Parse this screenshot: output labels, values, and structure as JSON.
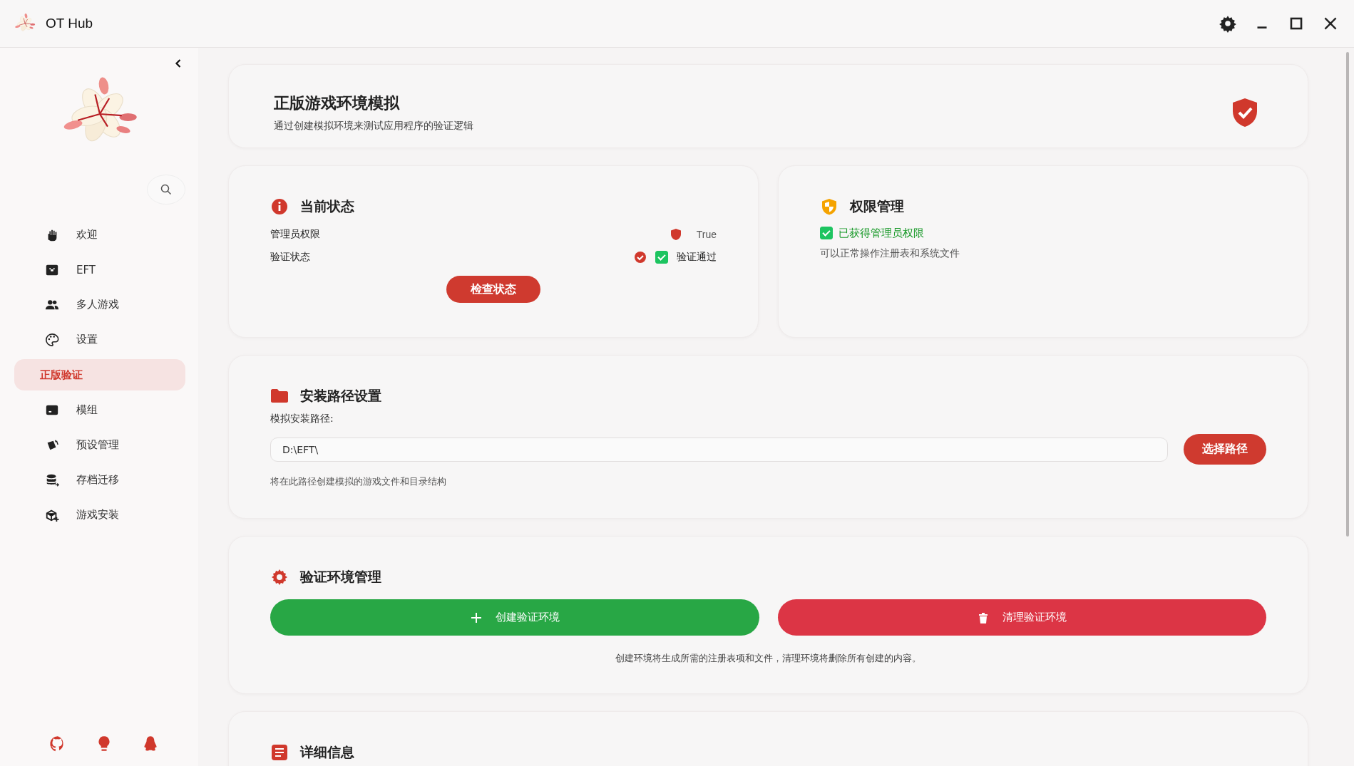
{
  "window": {
    "title": "OT Hub"
  },
  "sidebar": {
    "items": [
      {
        "label": "欢迎",
        "selected": false
      },
      {
        "label": "EFT",
        "selected": false
      },
      {
        "label": "多人游戏",
        "selected": false
      },
      {
        "label": "设置",
        "selected": false
      },
      {
        "label": "正版验证",
        "selected": true
      },
      {
        "label": "模组",
        "selected": false
      },
      {
        "label": "预设管理",
        "selected": false
      },
      {
        "label": "存档迁移",
        "selected": false
      },
      {
        "label": "游戏安装",
        "selected": false
      }
    ]
  },
  "hero": {
    "title": "正版游戏环境模拟",
    "subtitle": "通过创建模拟环境来测试应用程序的验证逻辑"
  },
  "status_card": {
    "title": "当前状态",
    "rows": [
      {
        "label": "管理员权限",
        "kind": "shield",
        "value": "True"
      },
      {
        "label": "验证状态",
        "kind": "verified",
        "value": "验证通过",
        "checked": true
      }
    ],
    "button": "检查状态"
  },
  "permission_card": {
    "title": "权限管理",
    "granted": {
      "label": "已获得管理员权限",
      "checked": true
    },
    "note": "可以正常操作注册表和系统文件"
  },
  "path_card": {
    "title": "安装路径设置",
    "field_label": "模拟安装路径:",
    "value": "D:\\EFT\\",
    "button": "选择路径",
    "hint": "将在此路径创建模拟的游戏文件和目录结构"
  },
  "env_card": {
    "title": "验证环境管理",
    "buttons": [
      {
        "label": "创建验证环境",
        "kind": "create"
      },
      {
        "label": "清理验证环境",
        "kind": "clean"
      }
    ],
    "note": "创建环境将生成所需的注册表项和文件，清理环境将删除所有创建的内容。"
  },
  "details_card": {
    "title": "详细信息"
  }
}
